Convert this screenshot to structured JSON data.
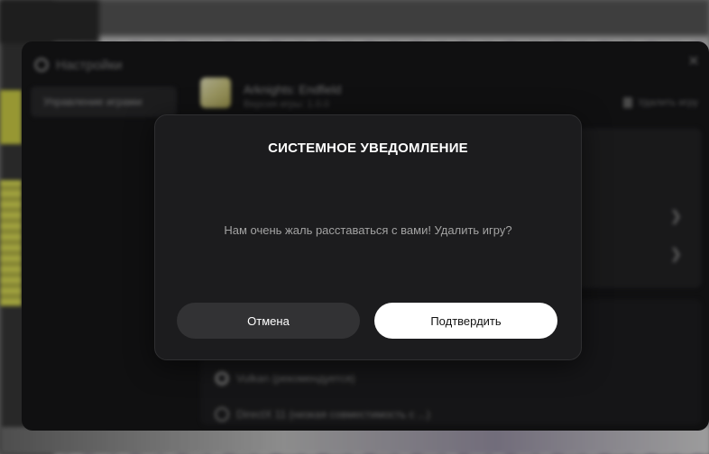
{
  "settings": {
    "title": "Настройки",
    "sidebar_item": "Управление играми",
    "game_name": "Arknights: Endfield",
    "game_version": "Версия игры: 1.0.0",
    "delete_label": "Удалить игру",
    "radio_1": "Vulkan (рекомендуется)",
    "radio_2": "DirectX 11 (низкая совместимость с ...)"
  },
  "dialog": {
    "title": "СИСТЕМНОЕ УВЕДОМЛЕНИЕ",
    "message": "Нам очень жаль расставаться с вами! Удалить игру?",
    "cancel_label": "Отмена",
    "confirm_label": "Подтвердить"
  },
  "colors": {
    "modal_bg": "#1c1c1e",
    "confirm_bg": "#ffffff",
    "cancel_bg": "#323234"
  }
}
